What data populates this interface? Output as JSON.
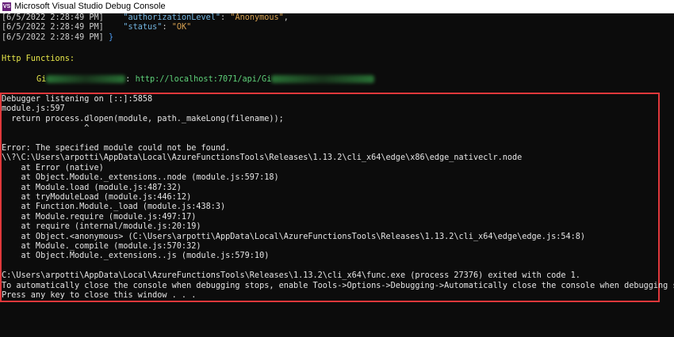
{
  "window": {
    "title": "Microsoft Visual Studio Debug Console",
    "icon": "visual-studio-icon"
  },
  "colors": {
    "background": "#0c0c0c",
    "text": "#cccccc",
    "highlight_border": "#e0383b",
    "yellow": "#e8e84a",
    "green": "#5fd27a"
  },
  "header_lines": [
    {
      "timestamp": "[6/5/2022 2:28:49 PM]",
      "key": "\"authorizationLevel\"",
      "sep": ": ",
      "value": "\"Anonymous\"",
      "tail": ","
    },
    {
      "timestamp": "[6/5/2022 2:28:49 PM]",
      "key": "\"status\"",
      "sep": ": ",
      "value": "\"OK\"",
      "tail": ""
    },
    {
      "timestamp": "[6/5/2022 2:28:49 PM]",
      "brace": "}"
    }
  ],
  "http_functions_label": "Http Functions:",
  "function_entry": {
    "name_prefix": "Gi",
    "separator": ": ",
    "url": "http://localhost:7071/api/Gi"
  },
  "error_lines": [
    "Debugger listening on [::]:5858",
    "module.js:597",
    "  return process.dlopen(module, path._makeLong(filename));",
    "                 ^",
    "",
    "Error: The specified module could not be found.",
    "\\\\?\\C:\\Users\\arpotti\\AppData\\Local\\AzureFunctionsTools\\Releases\\1.13.2\\cli_x64\\edge\\x86\\edge_nativeclr.node",
    "    at Error (native)",
    "    at Object.Module._extensions..node (module.js:597:18)",
    "    at Module.load (module.js:487:32)",
    "    at tryModuleLoad (module.js:446:12)",
    "    at Function.Module._load (module.js:438:3)",
    "    at Module.require (module.js:497:17)",
    "    at require (internal/module.js:20:19)",
    "    at Object.<anonymous> (C:\\Users\\arpotti\\AppData\\Local\\AzureFunctionsTools\\Releases\\1.13.2\\cli_x64\\edge\\edge.js:54:8)",
    "    at Module._compile (module.js:570:32)",
    "    at Object.Module._extensions..js (module.js:579:10)",
    "",
    "C:\\Users\\arpotti\\AppData\\Local\\AzureFunctionsTools\\Releases\\1.13.2\\cli_x64\\func.exe (process 27376) exited with code 1.",
    "To automatically close the console when debugging stops, enable Tools->Options->Debugging->Automatically close the console when debugging stops.",
    "Press any key to close this window . . ."
  ]
}
